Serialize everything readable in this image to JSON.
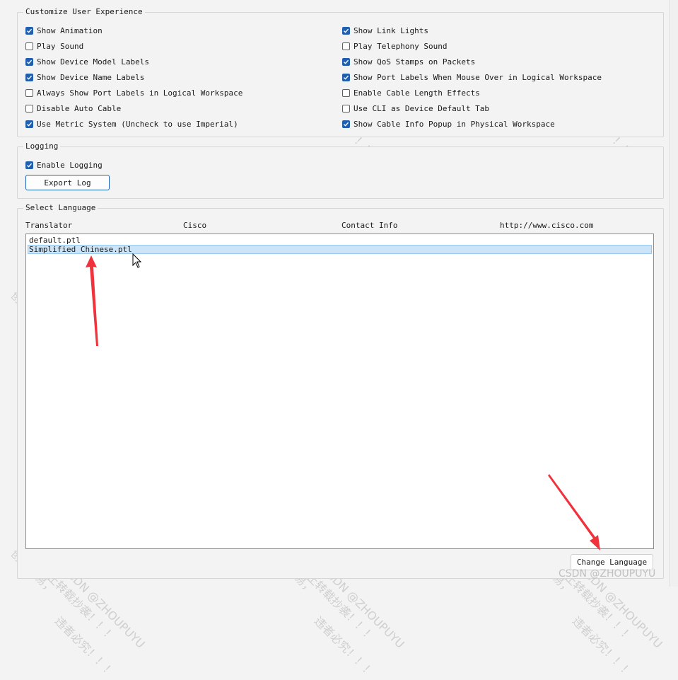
{
  "customize": {
    "title": "Customize User Experience",
    "left": [
      {
        "label": "Show Animation",
        "checked": true
      },
      {
        "label": "Play Sound",
        "checked": false
      },
      {
        "label": "Show Device Model Labels",
        "checked": true
      },
      {
        "label": "Show Device Name Labels",
        "checked": true
      },
      {
        "label": "Always Show Port Labels in Logical Workspace",
        "checked": false
      },
      {
        "label": "Disable Auto Cable",
        "checked": false
      },
      {
        "label": "Use Metric System (Uncheck to use Imperial)",
        "checked": true
      }
    ],
    "right": [
      {
        "label": "Show Link Lights",
        "checked": true
      },
      {
        "label": "Play Telephony Sound",
        "checked": false
      },
      {
        "label": "Show QoS Stamps on Packets",
        "checked": true
      },
      {
        "label": "Show Port Labels When Mouse Over in Logical Workspace",
        "checked": true
      },
      {
        "label": "Enable Cable Length Effects",
        "checked": false
      },
      {
        "label": "Use CLI as Device Default Tab",
        "checked": false
      },
      {
        "label": "Show Cable Info Popup in Physical Workspace",
        "checked": true
      }
    ]
  },
  "logging": {
    "title": "Logging",
    "enable": {
      "label": "Enable Logging",
      "checked": true
    },
    "export_label": "Export Log"
  },
  "language": {
    "title": "Select Language",
    "headers": {
      "translator": "Translator",
      "company": "Cisco",
      "contact": "Contact Info",
      "url": "http://www.cisco.com"
    },
    "items": [
      "default.ptl",
      "Simplified Chinese.ptl"
    ],
    "selected_index": 1,
    "change_label": "Change Language"
  },
  "watermark": {
    "text1": "创作不易，",
    "text2": "原创CSDN @ZHOUPUYU",
    "text3": "禁止转载抄袭！！！",
    "text4": "违者必究！！！",
    "footer": "CSDN @ZHOUPUYU"
  },
  "colors": {
    "accent": "#1f5fb0",
    "selection": "#cce4f7",
    "arrow": "#f0323c"
  }
}
